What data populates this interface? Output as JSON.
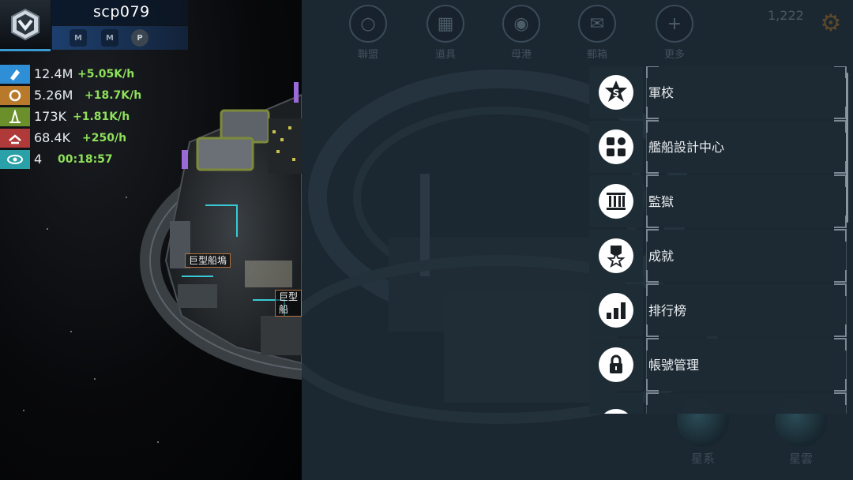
{
  "player": {
    "name": "scp079",
    "badges": [
      "M",
      "M",
      "P"
    ]
  },
  "resources": [
    {
      "icon": "crystal-icon",
      "color": "#2f8fd6",
      "amount": "12.4M",
      "rate": "+5.05K/h"
    },
    {
      "icon": "ore-icon",
      "color": "#b87a2a",
      "amount": "5.26M",
      "rate": "+18.7K/h"
    },
    {
      "icon": "energy-icon",
      "color": "#6b8f2a",
      "amount": "173K",
      "rate": "+1.81K/h"
    },
    {
      "icon": "parts-icon",
      "color": "#b03a3a",
      "amount": "68.4K",
      "rate": "+250/h"
    },
    {
      "icon": "eye-icon",
      "color": "#2aa0a8",
      "amount": "4",
      "rate": "00:18:57"
    }
  ],
  "scene": {
    "labels": [
      "巨型船塢",
      "巨型船"
    ]
  },
  "top_nav": [
    {
      "icon": "globe-icon",
      "label": "聯盟"
    },
    {
      "icon": "chest-icon",
      "label": "道具"
    },
    {
      "icon": "helmet-icon",
      "label": "母港"
    },
    {
      "icon": "mail-icon",
      "label": "郵箱"
    },
    {
      "icon": "plus-icon",
      "label": "更多"
    }
  ],
  "currency": {
    "amount": "1,222"
  },
  "bottom_nav": [
    {
      "icon": "galaxy-icon",
      "label": "星系"
    },
    {
      "icon": "nebula-icon",
      "label": "星雲"
    }
  ],
  "menu": {
    "items": [
      {
        "icon": "academy-icon",
        "label": "軍校"
      },
      {
        "icon": "ship-design-icon",
        "label": "艦船設計中心"
      },
      {
        "icon": "prison-icon",
        "label": "監獄"
      },
      {
        "icon": "achievement-icon",
        "label": "成就"
      },
      {
        "icon": "ranking-icon",
        "label": "排行榜"
      },
      {
        "icon": "lock-icon",
        "label": "帳號管理"
      },
      {
        "icon": "settings-icon",
        "label": ""
      }
    ]
  },
  "colors": {
    "accent_blue": "#3a9ad1",
    "rate_green": "#8fe05a",
    "panel_bg": "#1b2731"
  }
}
